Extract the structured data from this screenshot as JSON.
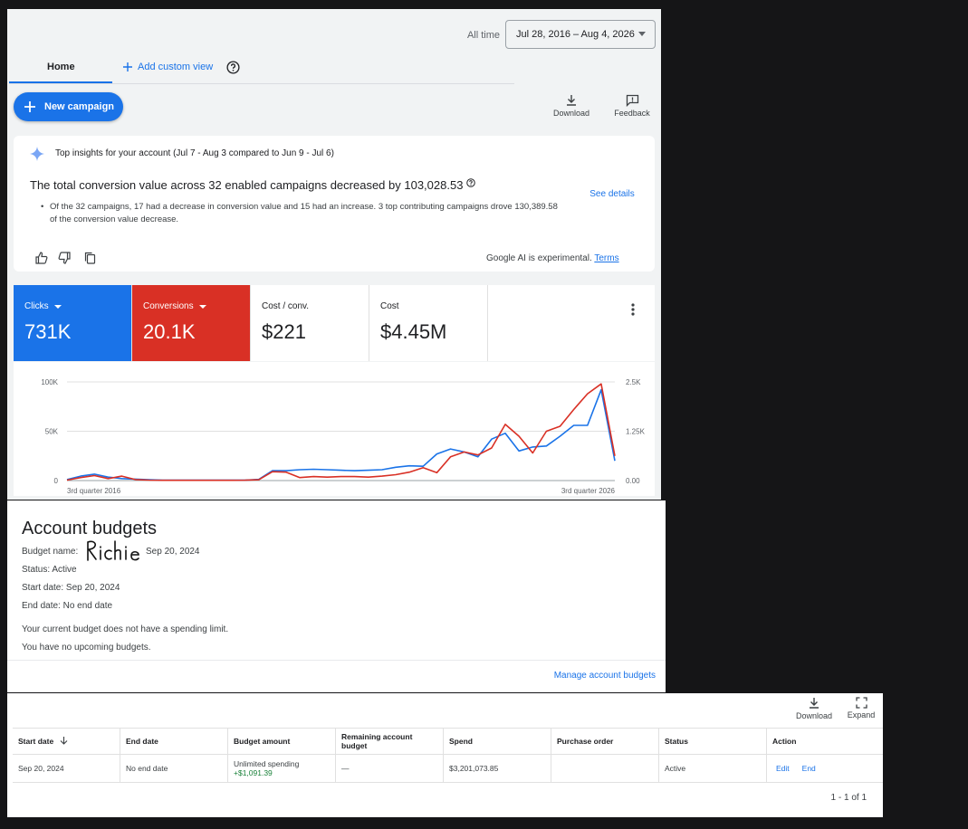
{
  "date_range": {
    "label": "All time",
    "value": "Jul 28, 2016 – Aug 4, 2026"
  },
  "tabs": {
    "home": "Home",
    "add_custom_view": "Add custom view"
  },
  "toolbar": {
    "new_campaign": "New campaign",
    "download": "Download",
    "feedback": "Feedback"
  },
  "insights": {
    "header": "Top insights for your account (Jul 7 - Aug 3 compared to Jun 9 - Jul 6)",
    "title": "The total conversion value across 32 enabled campaigns decreased by 103,028.53",
    "bullet": "Of the 32 campaigns, 17 had a decrease in conversion value and 15 had an increase. 3 top contributing campaigns drove 130,389.58 of the conversion value decrease.",
    "see_details": "See details",
    "ai_note": "Google AI is experimental.",
    "terms": "Terms"
  },
  "metrics": [
    {
      "label": "Clicks",
      "value": "731K",
      "color": "#1a73e8",
      "dropdown": true
    },
    {
      "label": "Conversions",
      "value": "20.1K",
      "color": "#d93025",
      "dropdown": true
    },
    {
      "label": "Cost / conv.",
      "value": "$221",
      "color": "#ffffff",
      "dropdown": false
    },
    {
      "label": "Cost",
      "value": "$4.45M",
      "color": "#ffffff",
      "dropdown": false
    }
  ],
  "chart_data": {
    "type": "line",
    "x_labels": [
      "3rd quarter 2016",
      "3rd quarter 2026"
    ],
    "left_axis": {
      "ticks": [
        "100K",
        "50K",
        "0"
      ],
      "range": [
        0,
        100000
      ]
    },
    "right_axis": {
      "ticks": [
        "2.5K",
        "1.25K",
        "0.00"
      ],
      "range": [
        0,
        2500
      ]
    },
    "series": [
      {
        "metric": "Clicks",
        "color": "#1a73e8",
        "axis": "left",
        "values": [
          1000,
          4500,
          6500,
          3500,
          2000,
          1500,
          800,
          500,
          400,
          400,
          400,
          400,
          400,
          400,
          1200,
          10000,
          10000,
          11000,
          11500,
          11000,
          10500,
          10000,
          10500,
          11000,
          13500,
          15000,
          14500,
          27000,
          32000,
          29000,
          24000,
          42000,
          48000,
          30000,
          34000,
          35000,
          45000,
          56000,
          56000,
          92000,
          20000
        ]
      },
      {
        "metric": "Conversions",
        "color": "#d93025",
        "axis": "left",
        "values": [
          500,
          3000,
          5000,
          2000,
          4500,
          1000,
          500,
          300,
          300,
          300,
          300,
          300,
          300,
          400,
          800,
          9000,
          8500,
          3000,
          4000,
          3500,
          4000,
          4000,
          3500,
          4500,
          6000,
          8500,
          13000,
          8000,
          24000,
          29000,
          26000,
          33000,
          57000,
          45000,
          28000,
          50000,
          55000,
          72000,
          88000,
          98000,
          25000
        ]
      }
    ]
  },
  "budget": {
    "title": "Account budgets",
    "name_label": "Budget name:",
    "signature": "Richie",
    "name_date": "Sep 20, 2024",
    "status_label": "Status:",
    "status_value": "Active",
    "start_label": "Start date:",
    "start_value": "Sep 20, 2024",
    "end_label": "End date:",
    "end_value": "No end date",
    "no_limit": "Your current budget does not have a spending limit.",
    "no_upcoming": "You have no upcoming budgets.",
    "manage": "Manage account budgets"
  },
  "table": {
    "download": "Download",
    "expand": "Expand",
    "columns": [
      "Start date",
      "End date",
      "Budget amount",
      "Remaining account budget",
      "Spend",
      "Purchase order",
      "Status",
      "Action"
    ],
    "row": {
      "start": "Sep 20, 2024",
      "end": "No end date",
      "amount": "Unlimited spending",
      "amount_delta": "+$1,091.39",
      "remaining": "—",
      "spend": "$3,201,073.85",
      "po": "",
      "status": "Active",
      "edit": "Edit",
      "end_action": "End"
    },
    "pager": "1 - 1 of 1"
  }
}
